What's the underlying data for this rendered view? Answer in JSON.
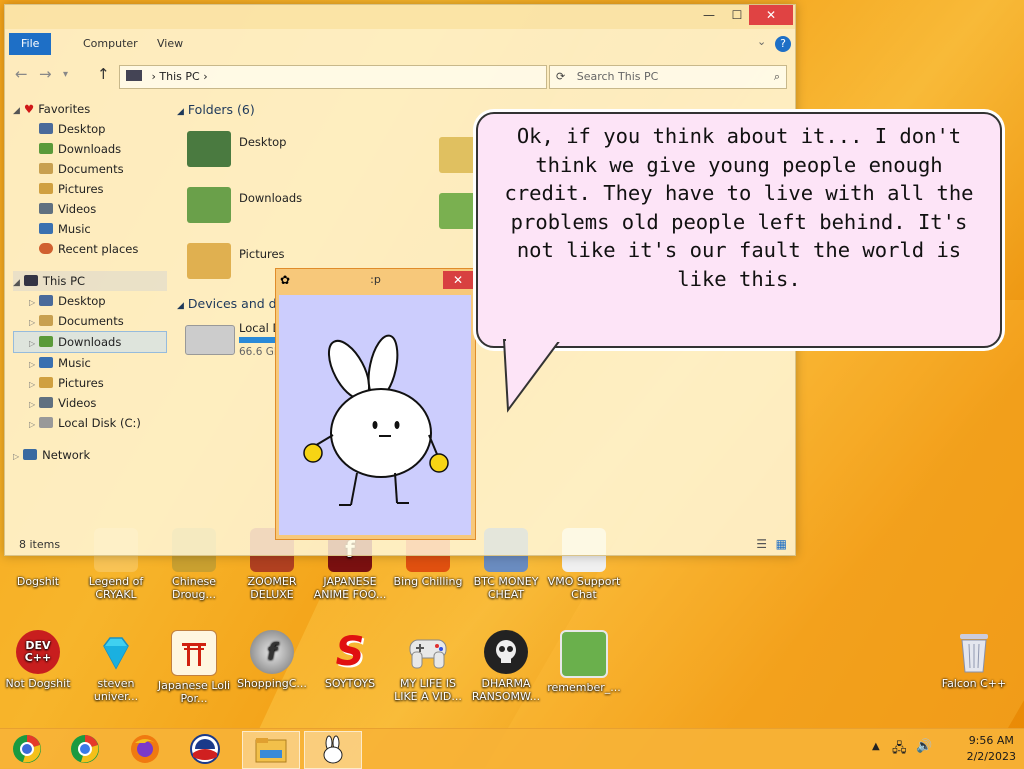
{
  "explorer": {
    "title_controls": {
      "minimize": "—",
      "maximize": "☐",
      "close": "✕"
    },
    "ribbon_tabs": [
      "File",
      "Computer",
      "View"
    ],
    "help_icon": "?",
    "address": "This PC",
    "search_placeholder": "Search This PC",
    "nav": {
      "favorites_label": "Favorites",
      "favorites": [
        "Desktop",
        "Downloads",
        "Documents",
        "Pictures",
        "Videos",
        "Music",
        "Recent places"
      ],
      "thispc_label": "This PC",
      "thispc": [
        "Desktop",
        "Documents",
        "Downloads",
        "Music",
        "Pictures",
        "Videos",
        "Local Disk (C:)"
      ],
      "network_label": "Network"
    },
    "folders_header": "Folders (6)",
    "folders": [
      "Desktop",
      "Downloads",
      "Pictures"
    ],
    "devices_header": "Devices and dr",
    "disk_label": "Local D",
    "disk_free": "66.6 GB",
    "status": "8 items"
  },
  "bunny_window": {
    "title": ":p",
    "close": "✕"
  },
  "bubble_text": "Ok, if you think about it... I don't think we give young people enough credit. They have to live with all the problems old people left behind. It's not like it's our fault the world is like this.",
  "desktop_row1": [
    "Dogshit",
    "Legend of CRYAKL",
    "Chinese Droug...",
    "ZOOMER DELUXE",
    "JAPANESE ANIME FOO...",
    "Bing Chilling",
    "BTC MONEY CHEAT",
    "VMO Support Chat"
  ],
  "desktop_row2": [
    "Not Dogshit",
    "steven univer...",
    "Japanese Loli Por...",
    "ShoppingC...",
    "SOYTOYS",
    "MY LIFE IS LIKE A VID...",
    "DHARMA RANSOMW...",
    "remember_..."
  ],
  "recycle_label": "Falcon C++",
  "icon_glyphs": {
    "devcpp": "DEV C++",
    "soytoys": "S",
    "flash": "f"
  },
  "tray": {
    "time": "9:56 AM",
    "date": "2/2/2023"
  },
  "colors": {
    "accent": "#1e6fc6",
    "bubble": "#fde4f7",
    "bunny_bg": "#cccdfd",
    "close": "#e04343"
  }
}
